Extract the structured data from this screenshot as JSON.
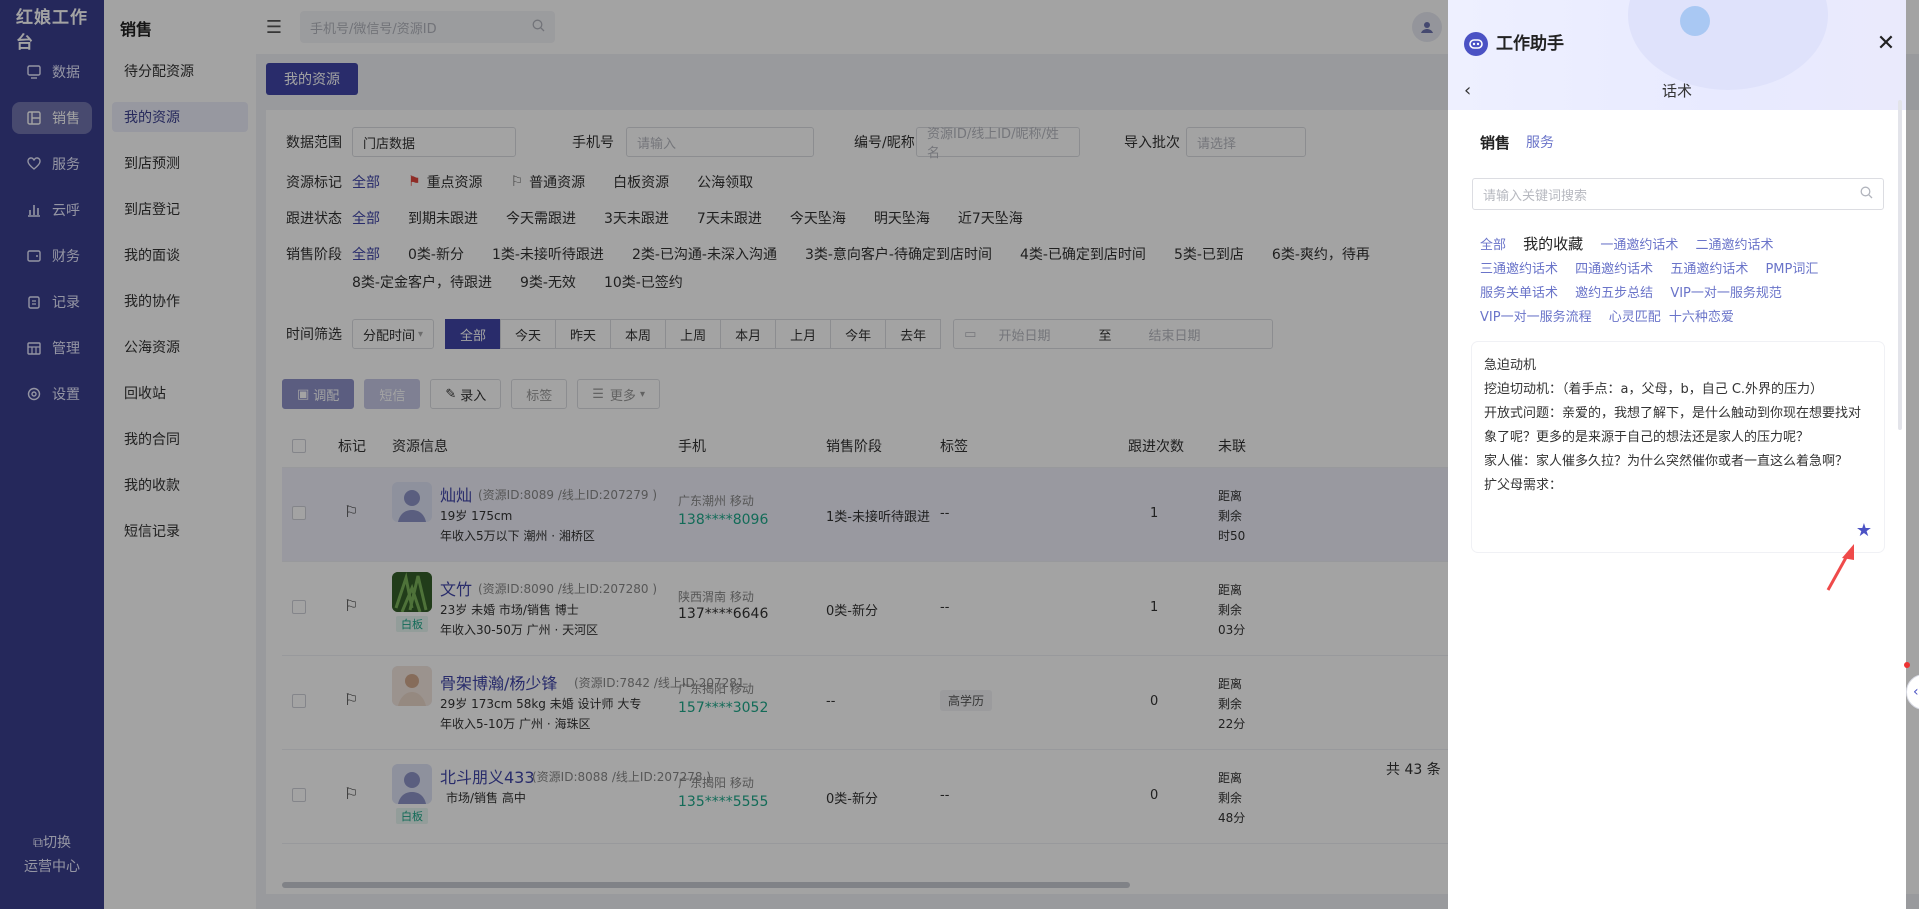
{
  "app": {
    "brand": "红娘工作台",
    "nav": [
      {
        "label": "数据",
        "icon": "monitor-icon"
      },
      {
        "label": "销售",
        "icon": "grid-icon",
        "active": true
      },
      {
        "label": "服务",
        "icon": "heart-icon"
      },
      {
        "label": "云呼",
        "icon": "bar-chart-icon"
      },
      {
        "label": "财务",
        "icon": "wallet-icon"
      },
      {
        "label": "记录",
        "icon": "clipboard-icon"
      },
      {
        "label": "管理",
        "icon": "building-icon"
      },
      {
        "label": "设置",
        "icon": "settings-icon"
      }
    ],
    "switch": {
      "line1": "切换",
      "line2": "运营中心"
    }
  },
  "subnav": {
    "title": "销售",
    "items": [
      "待分配资源",
      "我的资源",
      "到店预测",
      "到店登记",
      "我的面谈",
      "我的协作",
      "公海资源",
      "回收站",
      "我的合同",
      "我的收款",
      "短信记录"
    ],
    "active_index": 1
  },
  "topbar": {
    "search_placeholder": "手机号/微信号/资源ID"
  },
  "main": {
    "tab": "我的资源",
    "filters": {
      "scope_label": "数据范围",
      "scope_value": "门店数据",
      "phone_label": "手机号",
      "phone_placeholder": "请输入",
      "id_label": "编号/昵称",
      "id_placeholder": "资源ID/线上ID/昵称/姓名",
      "batch_label": "导入批次",
      "batch_placeholder": "请选择",
      "mark_label": "资源标记",
      "marks": [
        "全部",
        "重点资源",
        "普通资源",
        "白板资源",
        "公海领取"
      ],
      "follow_label": "跟进状态",
      "follows": [
        "全部",
        "到期未跟进",
        "今天需跟进",
        "3天未跟进",
        "7天未跟进",
        "今天坠海",
        "明天坠海",
        "近7天坠海"
      ],
      "stage_label": "销售阶段",
      "stages_row1": [
        "全部",
        "0类-新分",
        "1类-未接听待跟进",
        "2类-已沟通-未深入沟通",
        "3类-意向客户-待确定到店时间",
        "4类-已确定到店时间",
        "5类-已到店",
        "6类-爽约，待再"
      ],
      "stages_row2": [
        "8类-定金客户，待跟进",
        "9类-无效",
        "10类-已签约"
      ],
      "time_label": "时间筛选",
      "time_field": "分配时间",
      "time_ranges": [
        "全部",
        "今天",
        "昨天",
        "本周",
        "上周",
        "本月",
        "上月",
        "今年",
        "去年"
      ],
      "date_start_placeholder": "开始日期",
      "date_sep": "至",
      "date_end_placeholder": "结束日期"
    },
    "toolbar": [
      "调配",
      "短信",
      "录入",
      "标签",
      "更多"
    ],
    "columns": [
      "标记",
      "资源信息",
      "手机",
      "销售阶段",
      "标签",
      "跟进次数",
      "未联"
    ],
    "rows": [
      {
        "name": "灿灿",
        "ids": "(资源ID:8089 /线上ID:207279 )",
        "line1": "19岁  175cm",
        "line2": "年收入5万以下  潮州 · 湘桥区",
        "region": "广东潮州 移动",
        "phone": "138****8096",
        "stage": "1类-未接听待跟进",
        "tag": "--",
        "follow": "1",
        "extra": [
          "距离",
          "剩余",
          "时50"
        ],
        "badge": ""
      },
      {
        "name": "文竹",
        "ids": "(资源ID:8090 /线上ID:207280 )",
        "line1": "23岁  未婚  市场/销售  博士",
        "line2": "年收入30-50万  广州 · 天河区",
        "region": "陕西渭南 移动",
        "phone": "137****6646",
        "stage": "0类-新分",
        "tag": "--",
        "follow": "1",
        "extra": [
          "距离",
          "剩余",
          "03分"
        ],
        "badge": "白板"
      },
      {
        "name": "骨架博瀚/杨少锋",
        "ids": "(资源ID:7842 /线上ID:207281",
        "line1": "29岁  173cm  58kg  未婚  设计师  大专",
        "line2": "年收入5-10万  广州 · 海珠区",
        "region": "广东揭阳 移动",
        "phone": "157****3052",
        "stage": "--",
        "tag": "高学历",
        "follow": "0",
        "extra": [
          "距离",
          "剩余",
          "22分"
        ],
        "badge": ""
      },
      {
        "name": "北斗朋义433",
        "ids": "(资源ID:8088 /线上ID:207278 )",
        "line1": "市场/销售  高中",
        "line2": "",
        "region": "广东揭阳 移动",
        "phone": "135****5555",
        "stage": "0类-新分",
        "tag": "--",
        "follow": "0",
        "extra": [
          "距离",
          "剩余",
          "48分"
        ],
        "badge": "白板"
      }
    ],
    "total": "共 43 条"
  },
  "drawer": {
    "title": "工作助手",
    "subtitle": "话术",
    "tabs": [
      "销售",
      "服务"
    ],
    "search_placeholder": "请输入关键词搜索",
    "categories": [
      "全部",
      "我的收藏",
      "一通邀约话术",
      "二通邀约话术",
      "三通邀约话术",
      "四通邀约话术",
      "五通邀约话术",
      "PMP词汇",
      "服务关单话术",
      "邀约五步总结",
      "VIP一对一服务规范",
      "VIP一对一服务流程",
      "心灵匹配",
      "十六种恋爱"
    ],
    "active_category": 1,
    "card_lines": [
      "急迫动机",
      "挖迫切动机：（着手点：a，父母，b，自己 C.外界的压力）",
      "开放式问题：亲爱的，我想了解下，是什么触动到你现在想要找对象了呢？更多的是来源于自己的想法还是家人的压力呢？",
      "家人催：家人催多久拉？为什么突然催你或者一直这么着急啊？",
      "扩父母需求："
    ],
    "accent": "#4b52c4"
  }
}
